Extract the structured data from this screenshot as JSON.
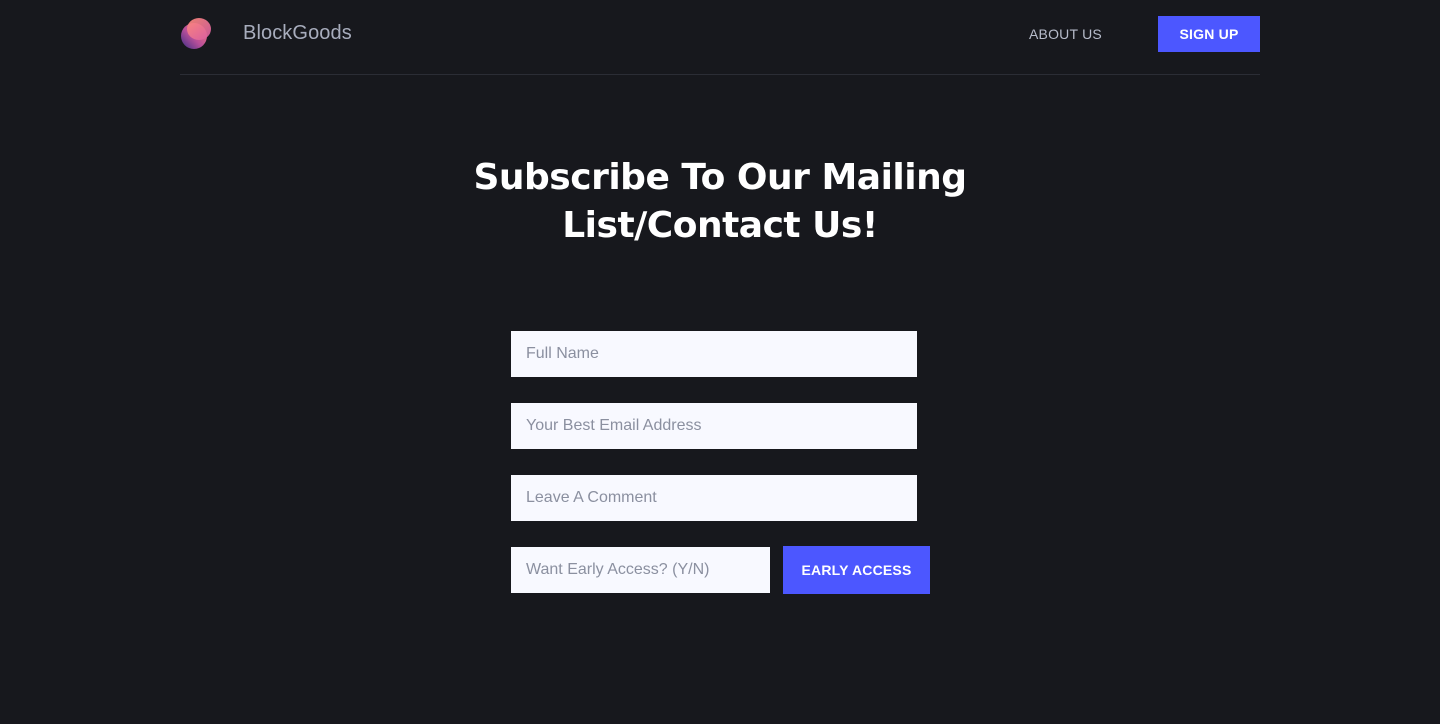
{
  "header": {
    "brand_name": "BlockGoods",
    "logo_icon": "gradient-logo-icon",
    "nav": {
      "about_label": "ABOUT US",
      "signup_label": "SIGN UP"
    }
  },
  "main": {
    "title_line1": "Subscribe To Our Mailing",
    "title_line2": "List/Contact Us!",
    "form": {
      "full_name": {
        "value": "",
        "placeholder": "Full Name"
      },
      "email": {
        "value": "",
        "placeholder": "Your Best Email Address"
      },
      "comment": {
        "value": "",
        "placeholder": "Leave A Comment"
      },
      "early_access": {
        "value": "",
        "placeholder": "Want Early Access? (Y/N)"
      },
      "submit_label": "EARLY ACCESS"
    }
  },
  "colors": {
    "background": "#17181d",
    "accent": "#4c57ff",
    "input_background": "#f8f9ff",
    "muted_text": "#a8adbd"
  }
}
